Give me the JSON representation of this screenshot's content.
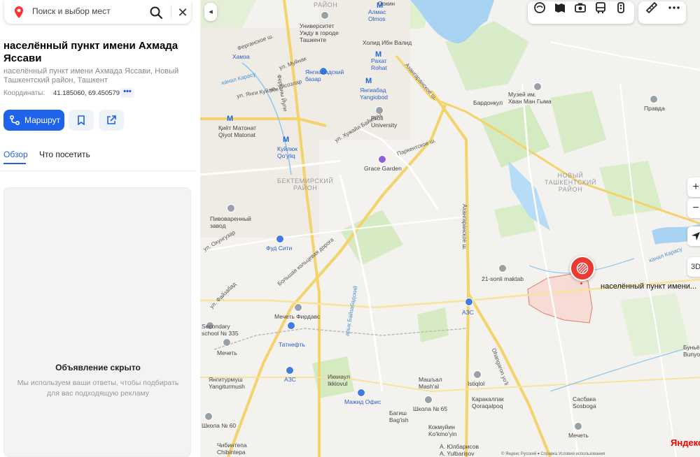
{
  "search": {
    "placeholder": "Поиск и выбор мест"
  },
  "place": {
    "title": "населённый пункт имени Ахмада Яссави",
    "subtitle": "населённый пункт имени Ахмада Яссави, Новый Ташкентский район, Ташкент",
    "coords_label": "Координаты:",
    "coords_value": "41.185060, 69.450579",
    "coords_more": "•••"
  },
  "actions": {
    "route_label": "Маршрут"
  },
  "tabs": [
    {
      "label": "Обзор"
    },
    {
      "label": "Что посетить"
    }
  ],
  "ad": {
    "title": "Объявление скрыто",
    "text": "Мы используем ваши ответы, чтобы подбирать для вас подходящую рекламу"
  },
  "map": {
    "marker_label": "населённый пункт имени...",
    "brand": "Яндекс",
    "collapse_icon": "◂",
    "zoom_in": "+",
    "zoom_out": "−",
    "three_d": "3D",
    "copyright": "© Яндекс   Русский ▾   Справка   Условия использования",
    "labels": {
      "almas": "Алмас\nOlmos",
      "uzbekistan_uni": "Университет\nУжду в городе\nТашкенте",
      "holid": "Холид Ибн Валид",
      "rahat": "Рахат\nRohat",
      "yangiabad_bazaar": "Янгиабадский\nбазар",
      "yangiabad": "Янгиабад\nYangiobod",
      "profi": "Profi\nUniversity",
      "grace": "Grace Garden",
      "kiyot": "Қиёт Матонат\nQiyot Matonat",
      "kuylyuk": "Куйлюк\nQo'yliq",
      "hamza": "Хамза",
      "bektemir": "БЕКТЕМИРСКИЙ\nРАЙОН",
      "brewery": "Пивоваренный\nзавод",
      "food_city": "Фуд Сити",
      "mecheti_firdavs": "Мечеть Фирдавс",
      "tatneft": "Татнефть",
      "azs1": "АЗС",
      "azs2": "АЗС",
      "school335": "Secondary\nschool № 335",
      "mecheti1": "Мечеть",
      "yangiturmush": "Янгитурмуш\nYangiturmush",
      "ikkiaul": "Иккиаул\nIkkiovul",
      "mazhid": "Мажид Офис",
      "mashal": "Машъал\nMash'al",
      "istiqlol": "Istiqlol",
      "karakalpak": "Каракалпак\nQoraqalpoq",
      "school65": "Школа № 65",
      "bagish": "Багиш\nBag'ish",
      "kokmuyin": "Кокмуйин\nKo'kmo'yin",
      "yulbarisov": "А. Юлбарисов\nA. Yulbarisov",
      "chibintepa": "Чибинтепа\nChibintepa",
      "school60": "Школа № 60",
      "sasbaka": "Сасбака\nSosboga",
      "mecheti2": "Мечеть",
      "bunyod": "Буньё\nBunyo",
      "maktab": "21-sonli maktab",
      "new_tashkent": "НОВЫЙ\nТАШКЕНТСКИЙ\nРАЙОН",
      "museum": "Музей им.\nХван Ман Гыма",
      "bardonkul": "Бардонкул",
      "pravda": "Правда",
      "raion_top": "РАЙОН",
      "sokin": "Сокин",
      "r_akhangaran1": "Ахангаранское ш.",
      "r_akhangaran2": "Ахангаранское ш.",
      "r_parkent": "Паркентское ш.",
      "r_bolshaya": "Большая кольцевая дорога",
      "r_ohangaron": "Ohangaron yo'li",
      "r_hudjaibon": "ул. Хужайи Байкары",
      "r_fergana": "Ферганское ш.",
      "r_fergana2": "Ферганы Йули",
      "r_faizabad": "ул. Файзабад",
      "r_oxunguzar": "ул. Охунгузар",
      "r_muinok": "ул. Муйнак",
      "r_uilsoy": "ул. Уйсозлар",
      "r_yangi": "ул. Янги Куйлюк",
      "r_kanal": "канал Карасу",
      "r_bayzabad": "арык Байзабадский",
      "r_kanal2": "канал Карасу"
    }
  },
  "colors": {
    "accent": "#1e63e9",
    "marker": "#e93a34",
    "brand": "#e00000"
  }
}
